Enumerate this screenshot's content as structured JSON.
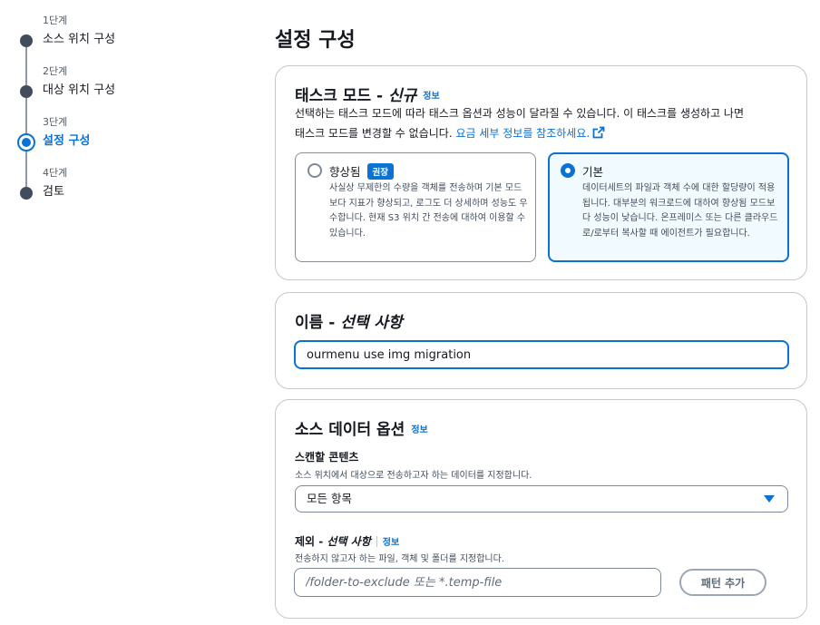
{
  "steps": [
    {
      "number": "1단계",
      "title": "소스 위치 구성"
    },
    {
      "number": "2단계",
      "title": "대상 위치 구성"
    },
    {
      "number": "3단계",
      "title": "설정 구성"
    },
    {
      "number": "4단계",
      "title": "검토"
    }
  ],
  "page_title": "설정 구성",
  "task_mode": {
    "title": "태스크 모드 - ",
    "title_em": "신규",
    "info": "정보",
    "desc_line1": "선택하는 태스크 모드에 따라 태스크 옵션과 성능이 달라질 수 있습니다. 이 태스크를 생성하고 나면",
    "desc_line2": "태스크 모드를 변경할 수 없습니다. ",
    "desc_link": "요금 세부 정보를 참조하세요.",
    "options": [
      {
        "title": "향상됨",
        "badge": "권장",
        "desc": "사실상 무제한의 수량을 객체를 전송하며 기본 모드보다 지표가 향상되고, 로그도 더 상세하며 성능도 우수합니다. 현재 S3 위치 간 전송에 대하여 이용할 수 있습니다."
      },
      {
        "title": "기본",
        "desc": "데이터세트의 파일과 객체 수에 대한 할당량이 적용됩니다. 대부분의 워크로드에 대하여 향상됨 모드보다 성능이 낮습니다. 온프레미스 또는 다른 클라우드로/로부터 복사할 때 에이전트가 필요합니다."
      }
    ]
  },
  "name_section": {
    "title": "이름 - ",
    "title_em": "선택 사항",
    "value": "ourmenu use img migration"
  },
  "source_options": {
    "title": "소스 데이터 옵션",
    "info": "정보",
    "scan_label": "스캔할 콘텐츠",
    "scan_desc": "소스 위치에서 대상으로 전송하고자 하는 데이터를 지정합니다.",
    "scan_value": "모든 항목",
    "exclude_label": "제외 - ",
    "exclude_em": "선택 사항",
    "exclude_info": "정보",
    "exclude_desc": "전송하지 않고자 하는 파일, 객체 및 폴더를 지정합니다.",
    "exclude_placeholder": "/folder-to-exclude 또는 *.temp-file",
    "add_pattern": "패턴 추가"
  }
}
